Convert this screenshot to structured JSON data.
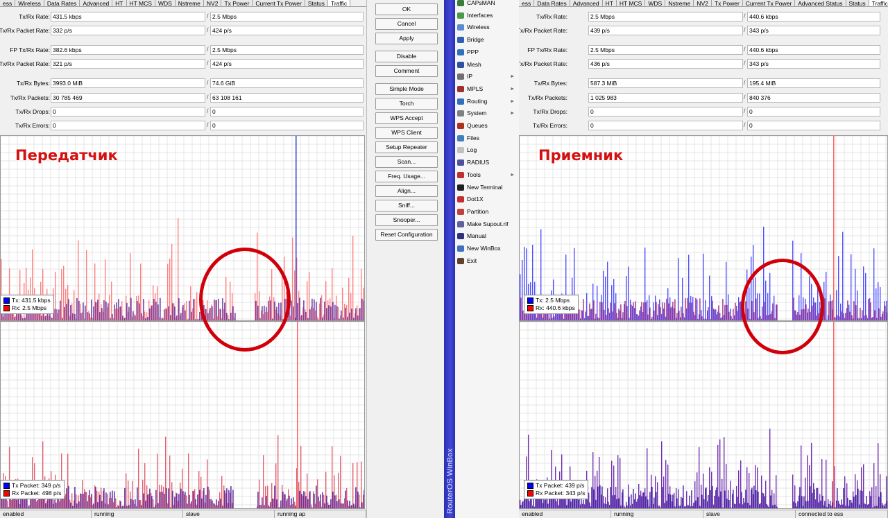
{
  "left": {
    "tabs": [
      "ess",
      "Wireless",
      "Data Rates",
      "Advanced",
      "HT",
      "HT MCS",
      "WDS",
      "Nstreme",
      "NV2",
      "Tx Power",
      "Current Tx Power",
      "Status",
      "Traffic"
    ],
    "fields": [
      {
        "label": "Tx/Rx Rate:",
        "tx": "431.5 kbps",
        "rx": "2.5 Mbps"
      },
      {
        "label": "Tx/Rx Packet Rate:",
        "tx": "332 p/s",
        "rx": "424 p/s"
      },
      {
        "label": "FP Tx/Rx Rate:",
        "tx": "382.6 kbps",
        "rx": "2.5 Mbps"
      },
      {
        "label": "FP Tx/Rx Packet Rate:",
        "tx": "321 p/s",
        "rx": "424 p/s"
      },
      {
        "label": "Tx/Rx Bytes:",
        "tx": "3993.0 MiB",
        "rx": "74.6 GiB"
      },
      {
        "label": "Tx/Rx Packets:",
        "tx": "30 785 469",
        "rx": "63 108 161"
      },
      {
        "label": "Tx/Rx Drops:",
        "tx": "0",
        "rx": "0"
      },
      {
        "label": "Tx/Rx Errors:",
        "tx": "0",
        "rx": "0"
      }
    ],
    "overlay_title": "Передатчик",
    "legend_rate": {
      "tx": "Tx:  431.5 kbps",
      "rx": "Rx:  2.5 Mbps"
    },
    "legend_packet": {
      "tx": "Tx Packet:  349 p/s",
      "rx": "Rx Packet:  498 p/s"
    },
    "status": [
      "enabled",
      "running",
      "slave",
      "running ap"
    ]
  },
  "right": {
    "tabs": [
      "ess",
      "Data Rates",
      "Advanced",
      "HT",
      "HT MCS",
      "WDS",
      "Nstreme",
      "NV2",
      "Tx Power",
      "Current Tx Power",
      "Advanced Status",
      "Status",
      "Traffic"
    ],
    "fields": [
      {
        "label": "Tx/Rx Rate:",
        "tx": "2.5 Mbps",
        "rx": "440.6 kbps"
      },
      {
        "label": "Tx/Rx Packet Rate:",
        "tx": "439 p/s",
        "rx": "343 p/s"
      },
      {
        "label": "FP Tx/Rx Rate:",
        "tx": "2.5 Mbps",
        "rx": "440.6 kbps"
      },
      {
        "label": "FP Tx/Rx Packet Rate:",
        "tx": "436 p/s",
        "rx": "343 p/s"
      },
      {
        "label": "Tx/Rx Bytes:",
        "tx": "587.3 MiB",
        "rx": "195.4 MiB"
      },
      {
        "label": "Tx/Rx Packets:",
        "tx": "1 025 983",
        "rx": "840 376"
      },
      {
        "label": "Tx/Rx Drops:",
        "tx": "0",
        "rx": "0"
      },
      {
        "label": "Tx/Rx Errors:",
        "tx": "0",
        "rx": "0"
      }
    ],
    "overlay_title": "Приемник",
    "legend_rate": {
      "tx": "Tx:  2.5 Mbps",
      "rx": "Rx:  440.6 kbps"
    },
    "legend_packet": {
      "tx": "Tx Packet:  439 p/s",
      "rx": "Rx Packet:  343 p/s"
    },
    "status": [
      "enabled",
      "running",
      "slave",
      "connected to ess"
    ]
  },
  "buttons": [
    "OK",
    "Cancel",
    "Apply",
    "Disable",
    "Comment",
    "Simple Mode",
    "Torch",
    "WPS Accept",
    "WPS Client",
    "Setup Repeater",
    "Scan...",
    "Freq. Usage...",
    "Align...",
    "Sniff...",
    "Snooper...",
    "Reset Configuration"
  ],
  "menu": {
    "brand": "RouterOS WinBox",
    "items": [
      {
        "label": "CAPsMAN",
        "icon": "capsman-icon",
        "color": "#3a7d3a",
        "sub": false
      },
      {
        "label": "Interfaces",
        "icon": "interfaces-icon",
        "color": "#4a9a4a",
        "sub": false
      },
      {
        "label": "Wireless",
        "icon": "wireless-icon",
        "color": "#5a8ad0",
        "sub": false
      },
      {
        "label": "Bridge",
        "icon": "bridge-icon",
        "color": "#3060b0",
        "sub": false
      },
      {
        "label": "PPP",
        "icon": "ppp-icon",
        "color": "#3070c0",
        "sub": false
      },
      {
        "label": "Mesh",
        "icon": "mesh-icon",
        "color": "#3050a0",
        "sub": false
      },
      {
        "label": "IP",
        "icon": "ip-icon",
        "color": "#707070",
        "sub": true
      },
      {
        "label": "MPLS",
        "icon": "mpls-icon",
        "color": "#a03030",
        "sub": true
      },
      {
        "label": "Routing",
        "icon": "routing-icon",
        "color": "#3070c0",
        "sub": true
      },
      {
        "label": "System",
        "icon": "system-icon",
        "color": "#808080",
        "sub": true
      },
      {
        "label": "Queues",
        "icon": "queues-icon",
        "color": "#b03020",
        "sub": false
      },
      {
        "label": "Files",
        "icon": "files-icon",
        "color": "#4080c0",
        "sub": false
      },
      {
        "label": "Log",
        "icon": "log-icon",
        "color": "#c0c0c0",
        "sub": false
      },
      {
        "label": "RADIUS",
        "icon": "radius-icon",
        "color": "#5050a0",
        "sub": false
      },
      {
        "label": "Tools",
        "icon": "tools-icon",
        "color": "#c03030",
        "sub": true
      },
      {
        "label": "New Terminal",
        "icon": "terminal-icon",
        "color": "#202020",
        "sub": false
      },
      {
        "label": "Dot1X",
        "icon": "dot1x-icon",
        "color": "#c03030",
        "sub": false
      },
      {
        "label": "Partition",
        "icon": "partition-icon",
        "color": "#c04040",
        "sub": false
      },
      {
        "label": "Make Supout.rif",
        "icon": "supout-icon",
        "color": "#6060a0",
        "sub": false
      },
      {
        "label": "Manual",
        "icon": "manual-icon",
        "color": "#303080",
        "sub": false
      },
      {
        "label": "New WinBox",
        "icon": "winbox-icon",
        "color": "#4070c0",
        "sub": false
      },
      {
        "label": "Exit",
        "icon": "exit-icon",
        "color": "#604030",
        "sub": false
      }
    ]
  },
  "colors": {
    "tx": "#0000ff",
    "rx": "#ff0000",
    "mark": "#d0000a"
  }
}
